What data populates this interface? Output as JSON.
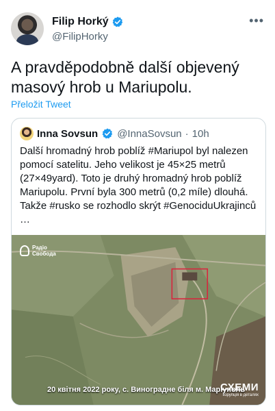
{
  "tweet": {
    "author_name": "Filip Horký",
    "author_handle": "@FilipHorky",
    "text": "A pravděpodobně další objevený masový hrob u Mariupolu.",
    "translate_label": "Přeložit Tweet"
  },
  "quote": {
    "author_name": "Inna Sovsun",
    "author_handle": "@InnaSovsun",
    "separator": "·",
    "time": "10h",
    "text": "Další hromadný hrob poblíž #Mariupol byl nalezen pomocí satelitu. Jeho velikost je 45×25 metrů (27×49yard). Toto je druhý hromadný hrob poblíž Mariupolu. První byla 300 metrů (0,2 míle) dlouhá. Takže #rusko se rozhodlo skrýt  #GenociduUkrajinců …"
  },
  "image": {
    "logo_line1": "Радіо",
    "logo_line2": "Свобода",
    "caption": "20 квітня 2022 року, с. Виноградне біля м. Маріуполь",
    "watermark": "СХЕМИ",
    "watermark_small": "корупція в деталях"
  },
  "colors": {
    "accent": "#1d9bf0",
    "marker": "#d7263d"
  }
}
